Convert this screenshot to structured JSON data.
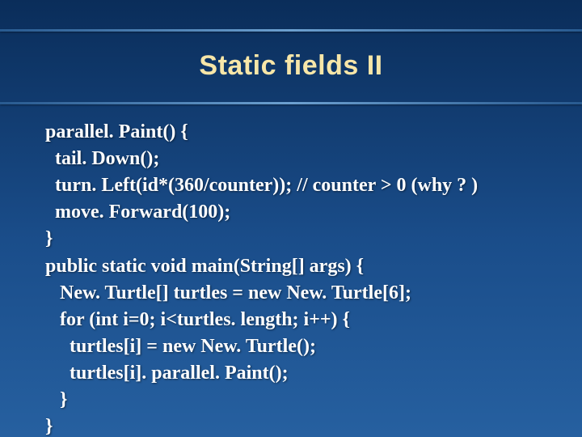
{
  "slide": {
    "title": "Static fields II",
    "code_lines": [
      "parallel. Paint() {",
      "  tail. Down();",
      "  turn. Left(id*(360/counter)); // counter > 0 (why ? )",
      "  move. Forward(100);",
      "}",
      "public static void main(String[] args) {",
      "   New. Turtle[] turtles = new New. Turtle[6];",
      "   for (int i=0; i<turtles. length; i++) {",
      "     turtles[i] = new New. Turtle();",
      "     turtles[i]. parallel. Paint();",
      "   }",
      "}"
    ]
  }
}
